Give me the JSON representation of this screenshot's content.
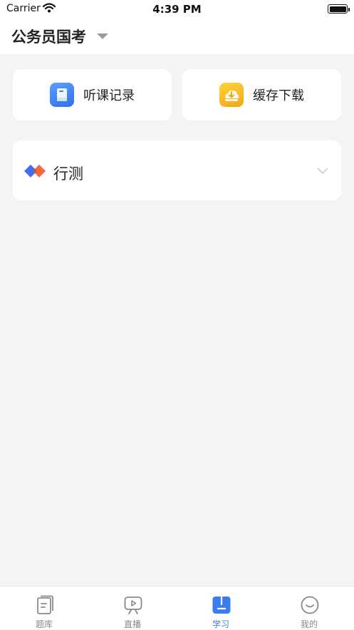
{
  "status_bar": {
    "carrier": "Carrier",
    "time": "4:39 PM"
  },
  "header": {
    "exam_title": "公务员国考"
  },
  "quick_actions": [
    {
      "label": "听课记录",
      "icon": "book-icon",
      "color": "#3b7cf2"
    },
    {
      "label": "缓存下载",
      "icon": "download-cloud-icon",
      "color": "#f5b41c"
    }
  ],
  "subject": {
    "label": "行测",
    "icon": "diamonds-icon",
    "colors": [
      "#3d6ff0",
      "#f26a3d"
    ]
  },
  "tabs": [
    {
      "label": "题库",
      "icon": "question-bank-icon",
      "active": false
    },
    {
      "label": "直播",
      "icon": "live-tv-icon",
      "active": false
    },
    {
      "label": "学习",
      "icon": "study-icon",
      "active": true
    },
    {
      "label": "我的",
      "icon": "smiley-icon",
      "active": false
    }
  ],
  "colors": {
    "accent": "#3b7cf2",
    "background": "#f4f4f4",
    "inactive_tab": "#888888"
  }
}
